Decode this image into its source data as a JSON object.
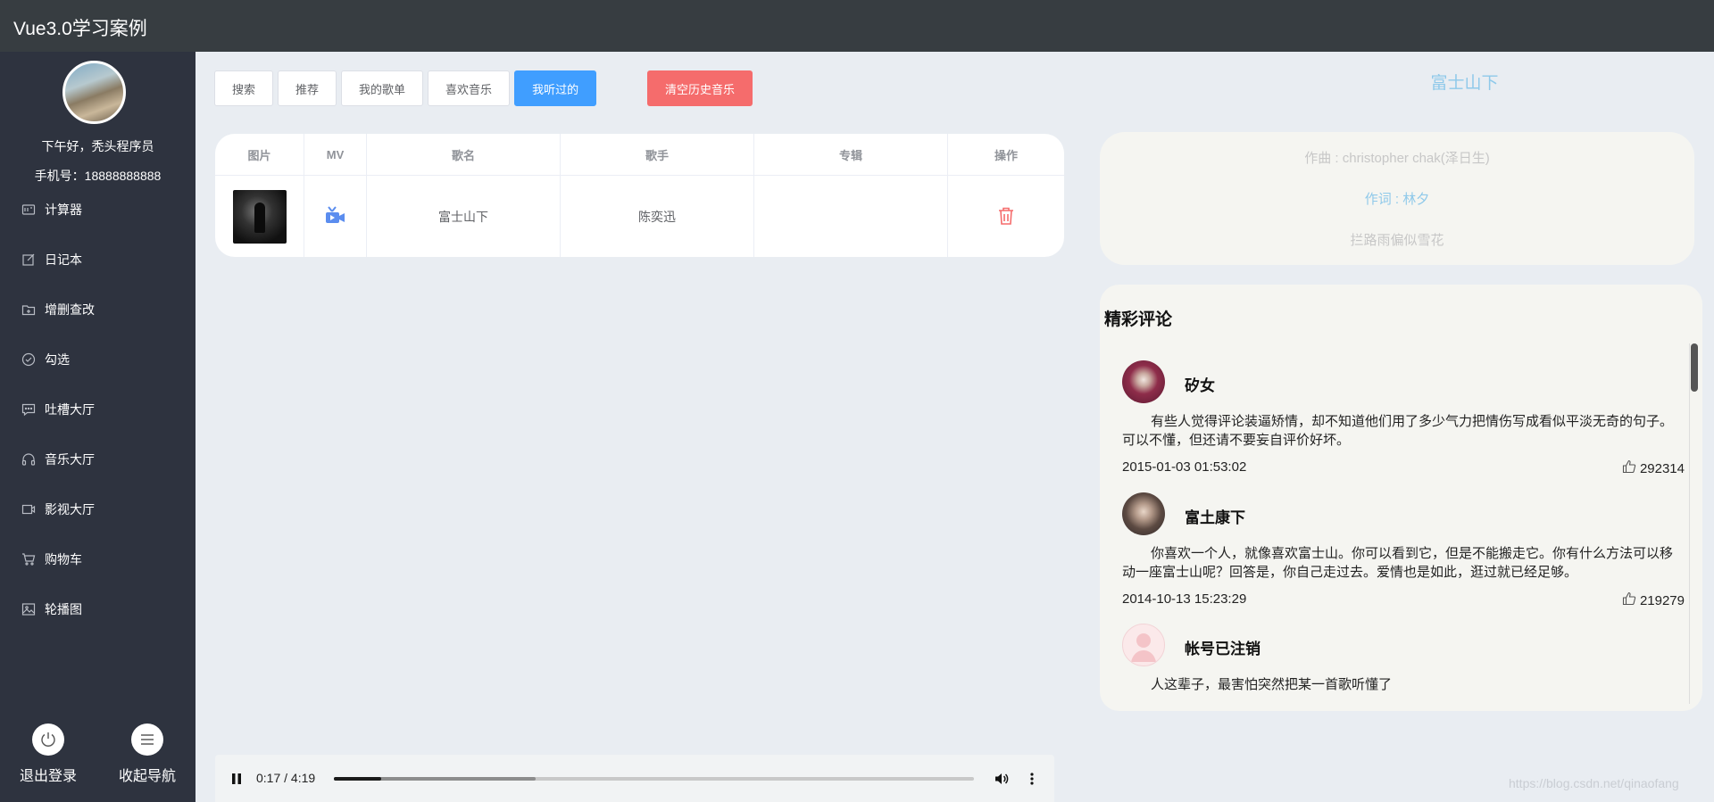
{
  "app": {
    "title": "Vue3.0学习案例"
  },
  "sidebar": {
    "greeting": "下午好，秃头程序员",
    "phone": "手机号：18888888888",
    "items": [
      {
        "label": "计算器",
        "icon": "calculator-icon"
      },
      {
        "label": "日记本",
        "icon": "edit-icon"
      },
      {
        "label": "增删查改",
        "icon": "folder-add-icon"
      },
      {
        "label": "勾选",
        "icon": "circle-check-icon"
      },
      {
        "label": "吐槽大厅",
        "icon": "chat-icon"
      },
      {
        "label": "音乐大厅",
        "icon": "headset-icon"
      },
      {
        "label": "影视大厅",
        "icon": "video-icon"
      },
      {
        "label": "购物车",
        "icon": "cart-icon"
      },
      {
        "label": "轮播图",
        "icon": "picture-icon"
      }
    ],
    "logout_label": "退出登录",
    "collapse_label": "收起导航"
  },
  "tabs": [
    {
      "label": "搜索",
      "active": false
    },
    {
      "label": "推荐",
      "active": false
    },
    {
      "label": "我的歌单",
      "active": false
    },
    {
      "label": "喜欢音乐",
      "active": false
    },
    {
      "label": "我听过的",
      "active": true
    }
  ],
  "clear_history_label": "清空历史音乐",
  "table": {
    "columns": [
      "图片",
      "MV",
      "歌名",
      "歌手",
      "专辑",
      "操作"
    ],
    "rows": [
      {
        "song": "富士山下",
        "singer": "陈奕迅",
        "album": ""
      }
    ]
  },
  "now_playing": {
    "title": "富士山下",
    "lyrics": [
      "作曲 : christopher chak(泽日生)",
      "作词 : 林夕",
      "拦路雨偏似雪花"
    ],
    "active_lyric": 1
  },
  "comments": {
    "heading": "精彩评论",
    "items": [
      {
        "name": "矽女",
        "text": "有些人觉得评论装逼矫情，却不知道他们用了多少气力把情伤写成看似平淡无奇的句子。可以不懂，但还请不要妄自评价好坏。",
        "time": "2015-01-03 01:53:02",
        "likes": "292314"
      },
      {
        "name": "富土康下",
        "text": "你喜欢一个人，就像喜欢富士山。你可以看到它，但是不能搬走它。你有什么方法可以移动一座富士山呢？回答是，你自己走过去。爱情也是如此，逛过就已经足够。",
        "time": "2014-10-13 15:23:29",
        "likes": "219279"
      },
      {
        "name": "帐号已注销",
        "text": "人这辈子，最害怕突然把某一首歌听懂了",
        "time": "",
        "likes": ""
      }
    ]
  },
  "player": {
    "time": "0:17 / 4:19",
    "progress": 0.074,
    "buffered": 0.315
  },
  "watermark": "https://blog.csdn.net/qinaofang",
  "colors": {
    "accent": "#409eff",
    "danger": "#f56c6c",
    "sidebar": "#2e333f",
    "topbar": "#373d41",
    "lyric_highlight": "#8fc9ea"
  }
}
